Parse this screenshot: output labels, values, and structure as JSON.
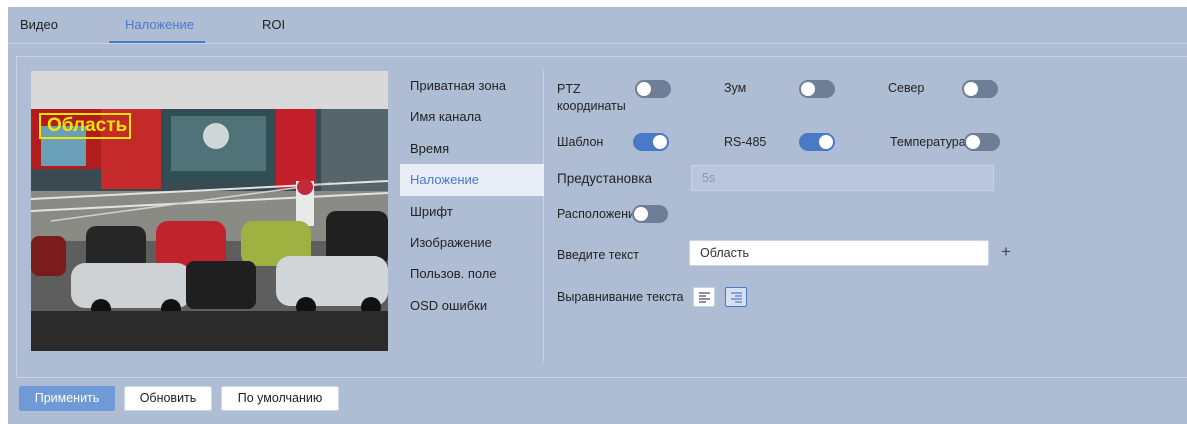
{
  "tabs": [
    {
      "label": "Видео"
    },
    {
      "label": "Наложение",
      "active": true
    },
    {
      "label": "ROI"
    }
  ],
  "preview": {
    "osd_text": "Область",
    "osd_color": "#f2e600"
  },
  "osd_menu": {
    "items": [
      {
        "label": "Приватная зона"
      },
      {
        "label": "Имя канала"
      },
      {
        "label": "Время"
      },
      {
        "label": "Наложение",
        "active": true
      },
      {
        "label": "Шрифт"
      },
      {
        "label": "Изображение"
      },
      {
        "label": "Пользов. поле"
      },
      {
        "label": "OSD ошибки"
      }
    ]
  },
  "settings": {
    "ptz_label": "PTZ координаты",
    "ptz_on": false,
    "zoom_label": "Зум",
    "zoom_on": false,
    "north_label": "Север",
    "north_on": false,
    "template_label": "Шаблон",
    "template_on": true,
    "rs485_label": "RS-485",
    "rs485_on": true,
    "temperature_label": "Температура",
    "temperature_on": false,
    "preset_label": "Предустановка",
    "preset_value": "5s",
    "location_label": "Расположени",
    "location_on": false,
    "text_label": "Введите текст",
    "text_value": "Область",
    "align_label": "Выравнивание текста",
    "align_selected": "right"
  },
  "buttons": {
    "apply": "Применить",
    "refresh": "Обновить",
    "default": "По умолчанию"
  },
  "colors": {
    "accent": "#4a79c8",
    "background": "#afbdd4",
    "toggle_off": "#6f7e97"
  }
}
